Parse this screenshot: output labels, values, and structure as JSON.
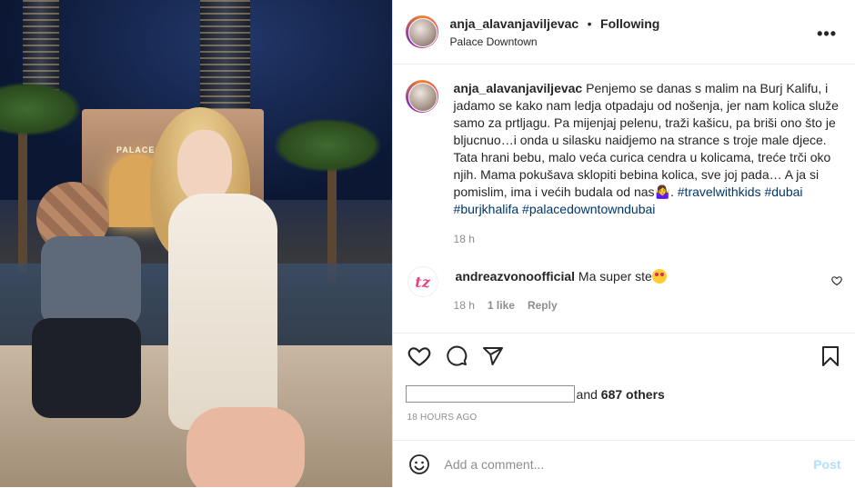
{
  "header": {
    "username": "anja_alavanjaviljevac",
    "separator": "•",
    "following_label": "Following",
    "location": "Palace Downtown",
    "more_icon": "more-horizontal-icon"
  },
  "caption": {
    "username": "anja_alavanjaviljevac",
    "text": "Penjemo se danas s malim na Burj Kalifu, i jadamo se kako nam ledja otpadaju od nošenja, jer nam kolica služe samo za prtljagu. Pa mijenjaj pelenu, traži kašicu, pa briši ono što je bljucnuo…i onda u silasku naidjemo na strance s troje male djece. Tata hrani bebu, malo veća curica cendra u kolicama, treće trči oko njih. Mama pokušava sklopiti bebina kolica, sve joj pada… A ja si pomislim, ima i većih budala od nas",
    "emoji_icon": "woman-shrugging-icon",
    "tags": [
      "#travelwithkids",
      "#dubai",
      "#burjkhalifa",
      "#palacedowntowndubai"
    ],
    "time": "18 h"
  },
  "comment": {
    "avatar_text": "tz",
    "username": "andreazvonoofficial",
    "text": "Ma super ste",
    "emoji_icon": "heart-eyes-icon",
    "time": "18 h",
    "likes": "1 like",
    "reply": "Reply"
  },
  "actions": {
    "icons": [
      "heart-icon",
      "comment-icon",
      "share-icon",
      "bookmark-icon"
    ]
  },
  "likes": {
    "prefix": "and",
    "count": "687 others"
  },
  "timestamp": "18 HOURS AGO",
  "add_comment": {
    "placeholder": "Add a comment...",
    "post_label": "Post"
  },
  "photo": {
    "sign_text": "PALACE"
  }
}
